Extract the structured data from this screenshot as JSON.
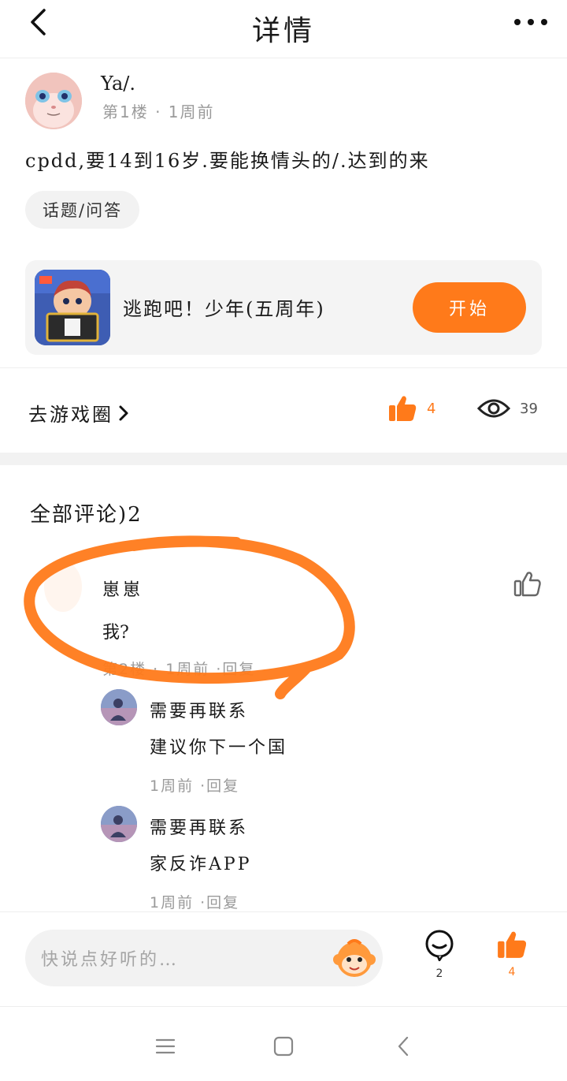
{
  "header": {
    "title": "详情"
  },
  "post": {
    "author": "Ya/.",
    "meta": "第1楼 · 1周前",
    "text": "cpdd,要14到16岁.要能换情头的/.达到的来",
    "tag": "话题/问答"
  },
  "game": {
    "name": "逃跑吧！少年(五周年)",
    "start_label": "开始"
  },
  "actions": {
    "circle_link": "去游戏圈",
    "like_count": "4",
    "view_count": "39"
  },
  "comments": {
    "title": "全部评论)2",
    "items": [
      {
        "name": "崽崽",
        "text": "我?",
        "meta": "第2楼 · 1周前 ·回复",
        "replies": [
          {
            "name": "需要再联系",
            "text": "建议你下一个国",
            "meta": "1周前 ·回复"
          },
          {
            "name": "需要再联系",
            "text": "家反诈APP",
            "meta": "1周前 ·回复"
          }
        ]
      }
    ]
  },
  "bottom": {
    "placeholder": "快说点好听的…",
    "comment_count": "2",
    "like_count": "4"
  },
  "colors": {
    "accent": "#ff7a1a",
    "annotation": "#ff7a1a"
  }
}
